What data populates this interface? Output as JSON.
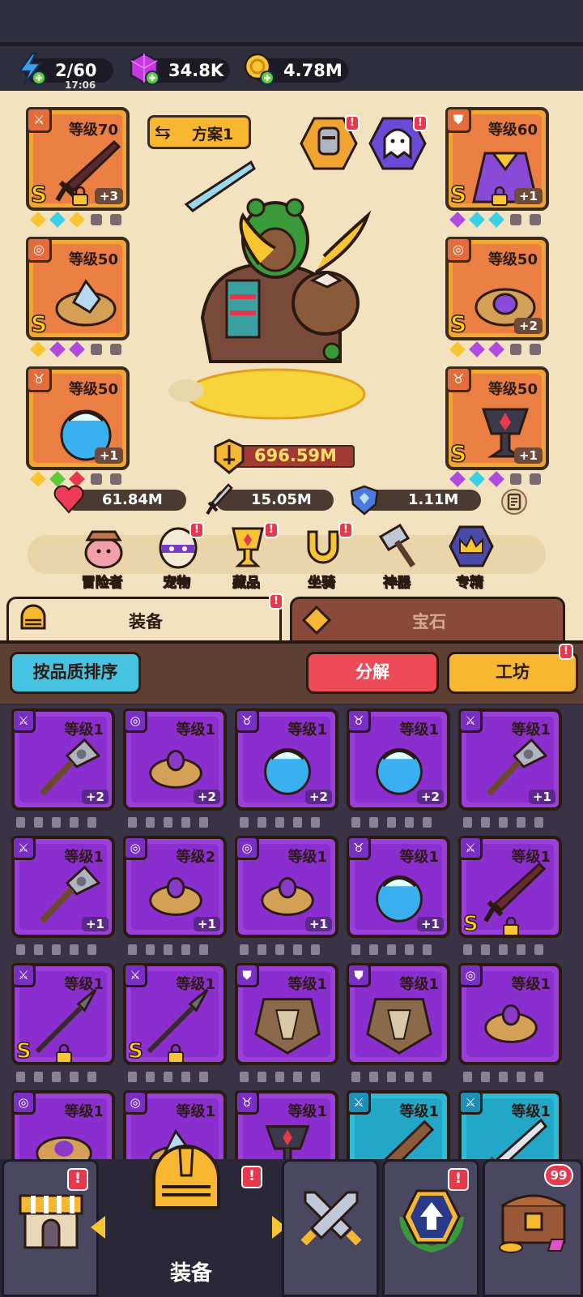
{
  "resources": {
    "energy": {
      "value": "2/60",
      "timer": "17:06",
      "icon": "lightning-icon"
    },
    "gems": {
      "value": "34.8K",
      "icon": "purple-gem-icon"
    },
    "gold": {
      "value": "4.78M",
      "icon": "gold-coin-icon"
    }
  },
  "hero": {
    "plan_label": "方案1",
    "left_slots": [
      {
        "type_icon": "sword-icon",
        "level": "等级70",
        "rank": "S",
        "plus": "+3",
        "locked": true
      },
      {
        "type_icon": "ring-icon",
        "level": "等级50",
        "rank": "S",
        "plus": "",
        "locked": false
      },
      {
        "type_icon": "necklace-icon",
        "level": "等级50",
        "rank": "",
        "plus": "+1",
        "locked": false
      }
    ],
    "right_slots": [
      {
        "type_icon": "armor-icon",
        "level": "等级60",
        "rank": "S",
        "plus": "+1",
        "locked": true
      },
      {
        "type_icon": "ring-icon",
        "level": "等级50",
        "rank": "S",
        "plus": "+2",
        "locked": false
      },
      {
        "type_icon": "necklace-icon",
        "level": "等级50",
        "rank": "S",
        "plus": "+1",
        "locked": false
      }
    ],
    "power": "696.59M",
    "stats": {
      "hp": "61.84M",
      "attack": "15.05M",
      "defense": "1.11M"
    }
  },
  "menu": [
    {
      "label": "冒险者",
      "icon": "adventurer-icon",
      "alert": false
    },
    {
      "label": "宠物",
      "icon": "pet-egg-icon",
      "alert": true
    },
    {
      "label": "藏品",
      "icon": "trophy-icon",
      "alert": true
    },
    {
      "label": "坐骑",
      "icon": "horseshoe-icon",
      "alert": true
    },
    {
      "label": "神器",
      "icon": "hammer-icon",
      "alert": false
    },
    {
      "label": "专精",
      "icon": "crown-icon",
      "alert": false
    }
  ],
  "tabs": {
    "equipment": "装备",
    "gems": "宝石"
  },
  "inventory": {
    "sort_label": "按品质排序",
    "dismantle_label": "分解",
    "workshop_label": "工坊",
    "items": [
      {
        "type": "sword",
        "level": "等级1",
        "plus": "+2",
        "rank": "",
        "lock": false,
        "color": "purple",
        "art": "mace"
      },
      {
        "type": "ring",
        "level": "等级1",
        "plus": "+2",
        "rank": "",
        "lock": false,
        "color": "purple",
        "art": "ring"
      },
      {
        "type": "necklace",
        "level": "等级1",
        "plus": "+2",
        "rank": "",
        "lock": false,
        "color": "purple",
        "art": "orb"
      },
      {
        "type": "necklace",
        "level": "等级1",
        "plus": "+2",
        "rank": "",
        "lock": false,
        "color": "purple",
        "art": "orb"
      },
      {
        "type": "sword",
        "level": "等级1",
        "plus": "+1",
        "rank": "",
        "lock": false,
        "color": "purple",
        "art": "mace"
      },
      {
        "type": "sword",
        "level": "等级1",
        "plus": "+1",
        "rank": "",
        "lock": false,
        "color": "purple",
        "art": "mace"
      },
      {
        "type": "ring",
        "level": "等级2",
        "plus": "+1",
        "rank": "",
        "lock": false,
        "color": "purple",
        "art": "ring"
      },
      {
        "type": "ring",
        "level": "等级1",
        "plus": "+1",
        "rank": "",
        "lock": false,
        "color": "purple",
        "art": "ring"
      },
      {
        "type": "necklace",
        "level": "等级1",
        "plus": "+1",
        "rank": "",
        "lock": false,
        "color": "purple",
        "art": "orb"
      },
      {
        "type": "sword",
        "level": "等级1",
        "plus": "",
        "rank": "S",
        "lock": true,
        "color": "purple",
        "art": "sword"
      },
      {
        "type": "sword",
        "level": "等级1",
        "plus": "",
        "rank": "S",
        "lock": true,
        "color": "purple",
        "art": "spear"
      },
      {
        "type": "sword",
        "level": "等级1",
        "plus": "",
        "rank": "S",
        "lock": true,
        "color": "purple",
        "art": "spear"
      },
      {
        "type": "armor",
        "level": "等级1",
        "plus": "",
        "rank": "",
        "lock": false,
        "color": "purple",
        "art": "armor"
      },
      {
        "type": "armor",
        "level": "等级1",
        "plus": "",
        "rank": "",
        "lock": false,
        "color": "purple",
        "art": "armor"
      },
      {
        "type": "ring",
        "level": "等级1",
        "plus": "",
        "rank": "",
        "lock": false,
        "color": "purple",
        "art": "ring"
      },
      {
        "type": "ring",
        "level": "等级1",
        "plus": "",
        "rank": "",
        "lock": false,
        "color": "purple",
        "art": "bracelet"
      },
      {
        "type": "ring",
        "level": "等级1",
        "plus": "",
        "rank": "",
        "lock": false,
        "color": "purple",
        "art": "crystal-ring"
      },
      {
        "type": "necklace",
        "level": "等级1",
        "plus": "",
        "rank": "",
        "lock": false,
        "color": "purple",
        "art": "chalice"
      },
      {
        "type": "sword",
        "level": "等级1",
        "plus": "",
        "rank": "",
        "lock": false,
        "color": "cyan",
        "art": "club"
      },
      {
        "type": "sword",
        "level": "等级1",
        "plus": "",
        "rank": "",
        "lock": false,
        "color": "cyan",
        "art": "blade"
      }
    ]
  },
  "nav": {
    "active_label": "装备",
    "chest_count": "99",
    "items": [
      "shop-icon",
      "equipment-helmet-icon",
      "battle-swords-icon",
      "upgrade-badge-icon",
      "treasure-chest-icon"
    ]
  }
}
